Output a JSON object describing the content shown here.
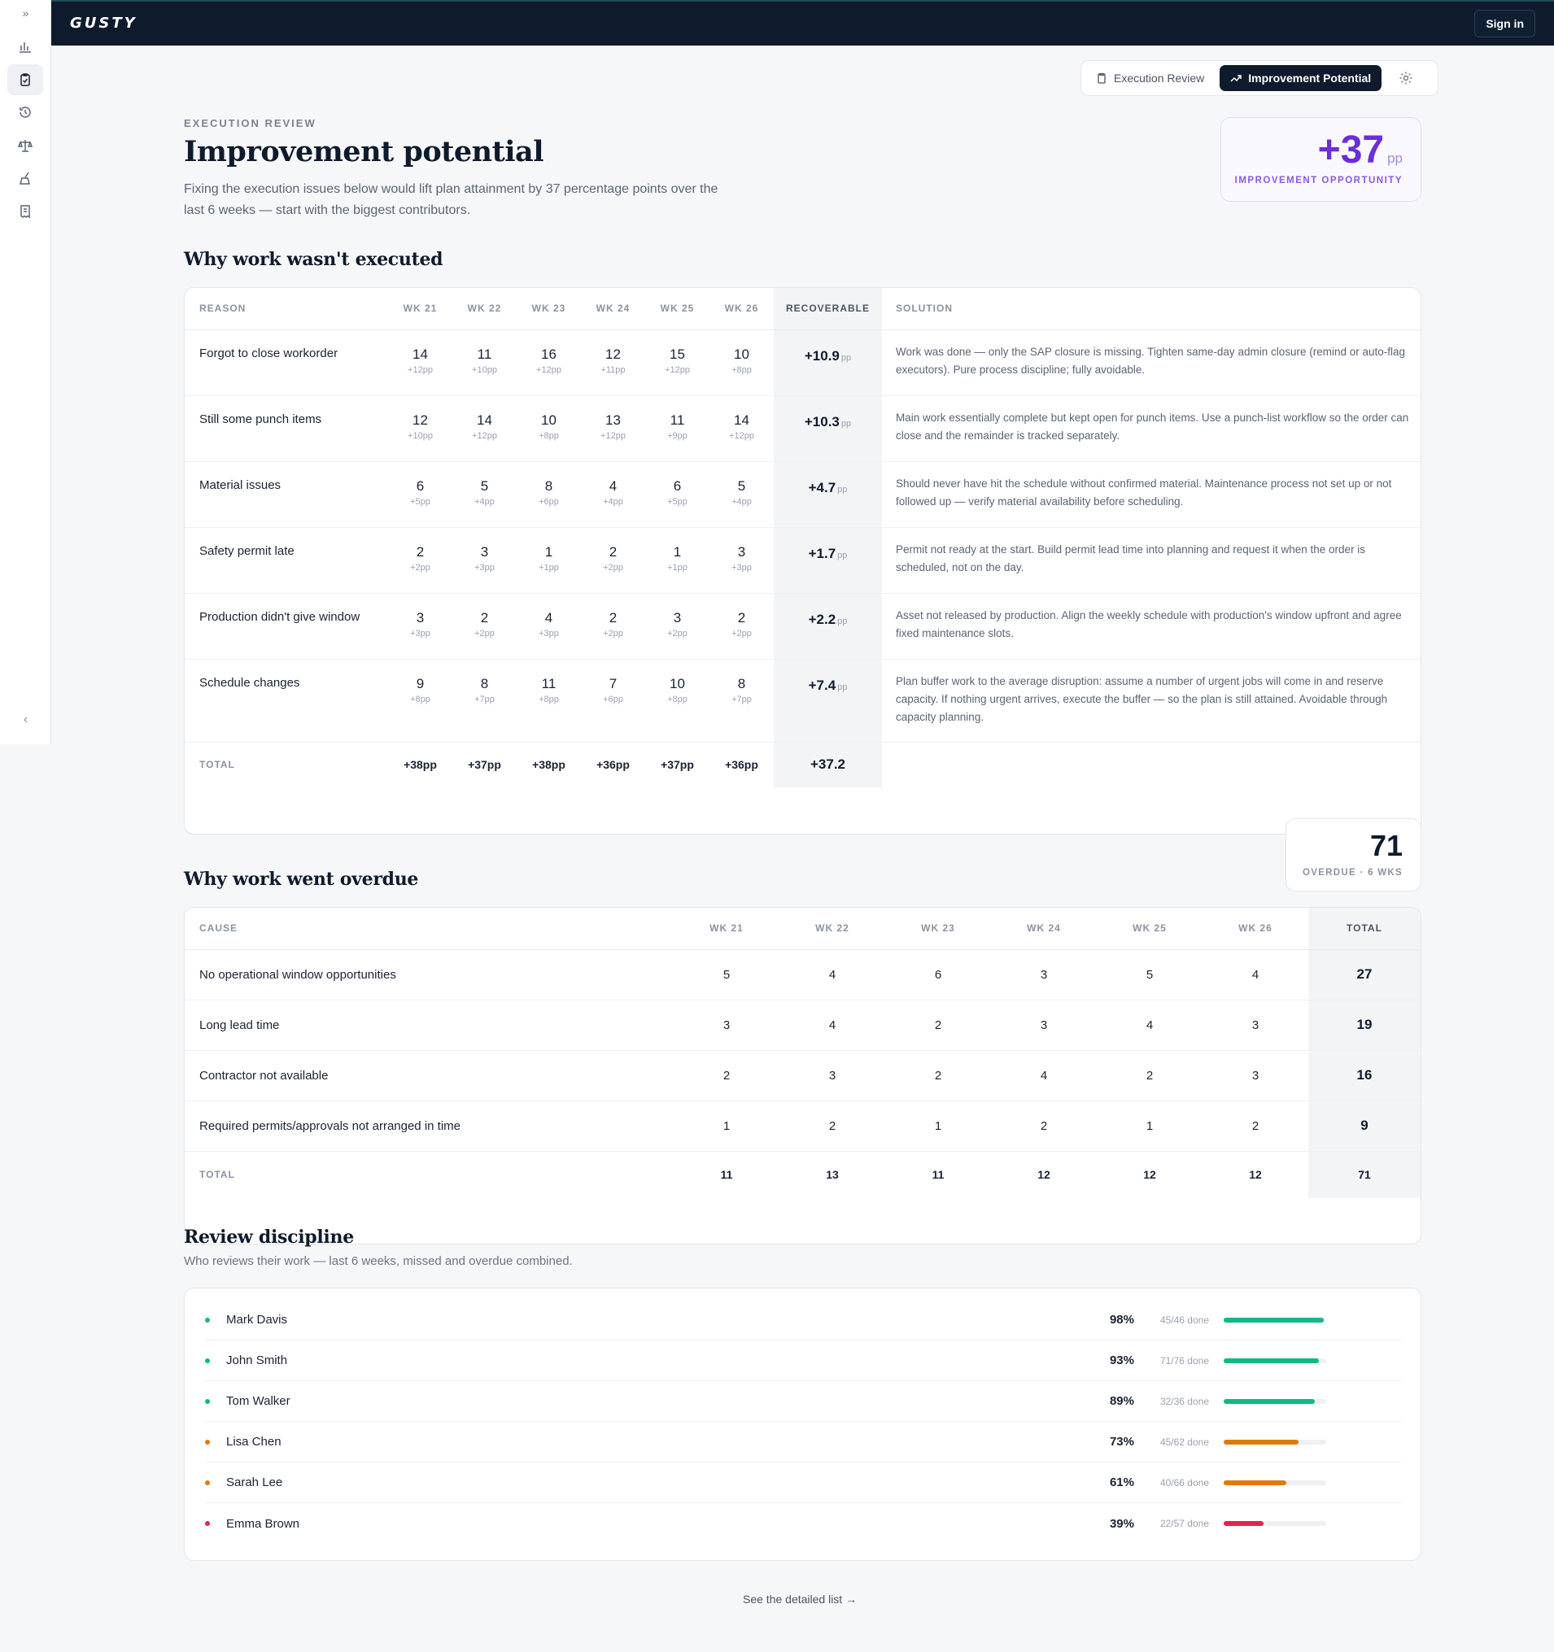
{
  "sidebar": {
    "expand_glyph": "»",
    "collapse_glyph": "‹",
    "items": [
      {
        "icon": "bar-chart-icon"
      },
      {
        "icon": "clipboard-check-icon",
        "active": true
      },
      {
        "icon": "history-icon"
      },
      {
        "icon": "scale-icon"
      },
      {
        "icon": "broom-icon"
      },
      {
        "icon": "receipt-icon"
      }
    ]
  },
  "topbar": {
    "logo": "GUSTY",
    "signin_label": "Sign in"
  },
  "tabs": [
    {
      "label": "Execution Review",
      "icon": "clipboard-icon",
      "active": false
    },
    {
      "label": "Improvement Potential",
      "icon": "trending-up-icon",
      "active": true
    }
  ],
  "header": {
    "eyebrow": "EXECUTION REVIEW",
    "title": "Improvement potential",
    "subtitle": "Fixing the execution issues below would lift plan attainment by 37 percentage points over the last 6 weeks — start with the biggest contributors."
  },
  "kpi": {
    "value": "+37",
    "unit": "pp",
    "label": "IMPROVEMENT OPPORTUNITY",
    "color": "#6a2fd6"
  },
  "not_executed": {
    "title": "Why work wasn't executed",
    "headers": [
      "REASON",
      "WK 21",
      "WK 22",
      "WK 23",
      "WK 24",
      "WK 25",
      "WK 26",
      "RECOVERABLE",
      "SOLUTION"
    ],
    "rows": [
      {
        "reason": "Forgot to close workorder",
        "counts": [
          "14",
          "11",
          "16",
          "12",
          "15",
          "10"
        ],
        "pp": [
          "+12pp",
          "+10pp",
          "+12pp",
          "+11pp",
          "+12pp",
          "+8pp"
        ],
        "recoverable": "+10.9",
        "unit": "pp",
        "solution": "Work was done — only the SAP closure is missing. Tighten same-day admin closure (remind or auto-flag executors). Pure process discipline; fully avoidable."
      },
      {
        "reason": "Still some punch items",
        "counts": [
          "12",
          "14",
          "10",
          "13",
          "11",
          "14"
        ],
        "pp": [
          "+10pp",
          "+12pp",
          "+8pp",
          "+12pp",
          "+9pp",
          "+12pp"
        ],
        "recoverable": "+10.3",
        "unit": "pp",
        "solution": "Main work essentially complete but kept open for punch items. Use a punch-list workflow so the order can close and the remainder is tracked separately."
      },
      {
        "reason": "Material issues",
        "counts": [
          "6",
          "5",
          "8",
          "4",
          "6",
          "5"
        ],
        "pp": [
          "+5pp",
          "+4pp",
          "+6pp",
          "+4pp",
          "+5pp",
          "+4pp"
        ],
        "recoverable": "+4.7",
        "unit": "pp",
        "solution": "Should never have hit the schedule without confirmed material. Maintenance process not set up or not followed up — verify material availability before scheduling."
      },
      {
        "reason": "Safety permit late",
        "counts": [
          "2",
          "3",
          "1",
          "2",
          "1",
          "3"
        ],
        "pp": [
          "+2pp",
          "+3pp",
          "+1pp",
          "+2pp",
          "+1pp",
          "+3pp"
        ],
        "recoverable": "+1.7",
        "unit": "pp",
        "solution": "Permit not ready at the start. Build permit lead time into planning and request it when the order is scheduled, not on the day."
      },
      {
        "reason": "Production didn't give window",
        "counts": [
          "3",
          "2",
          "4",
          "2",
          "3",
          "2"
        ],
        "pp": [
          "+3pp",
          "+2pp",
          "+3pp",
          "+2pp",
          "+2pp",
          "+2pp"
        ],
        "recoverable": "+2.2",
        "unit": "pp",
        "solution": "Asset not released by production. Align the weekly schedule with production's window upfront and agree fixed maintenance slots."
      },
      {
        "reason": "Schedule changes",
        "counts": [
          "9",
          "8",
          "11",
          "7",
          "10",
          "8"
        ],
        "pp": [
          "+8pp",
          "+7pp",
          "+8pp",
          "+6pp",
          "+8pp",
          "+7pp"
        ],
        "recoverable": "+7.4",
        "unit": "pp",
        "solution": "Plan buffer work to the average disruption: assume a number of urgent jobs will come in and reserve capacity. If nothing urgent arrives, execute the buffer — so the plan is still attained. Avoidable through capacity planning."
      }
    ],
    "total": {
      "label": "TOTAL",
      "weeks": [
        "+38pp",
        "+37pp",
        "+38pp",
        "+36pp",
        "+37pp",
        "+36pp"
      ],
      "recoverable": "+37.2"
    }
  },
  "overdue": {
    "title": "Why work went overdue",
    "kpi_value": "71",
    "kpi_label": "OVERDUE · 6 WKS",
    "headers": [
      "CAUSE",
      "WK 21",
      "WK 22",
      "WK 23",
      "WK 24",
      "WK 25",
      "WK 26",
      "TOTAL"
    ],
    "rows": [
      {
        "cause": "No operational window opportunities",
        "weeks": [
          "5",
          "4",
          "6",
          "3",
          "5",
          "4"
        ],
        "total": "27"
      },
      {
        "cause": "Long lead time",
        "weeks": [
          "3",
          "4",
          "2",
          "3",
          "4",
          "3"
        ],
        "total": "19"
      },
      {
        "cause": "Contractor not available",
        "weeks": [
          "2",
          "3",
          "2",
          "4",
          "2",
          "3"
        ],
        "total": "16"
      },
      {
        "cause": "Required permits/approvals not arranged in time",
        "weeks": [
          "1",
          "2",
          "1",
          "2",
          "1",
          "2"
        ],
        "total": "9"
      }
    ],
    "total": {
      "label": "TOTAL",
      "weeks": [
        "11",
        "13",
        "11",
        "12",
        "12",
        "12"
      ],
      "total": "71"
    }
  },
  "review": {
    "title": "Review discipline",
    "subtitle": "Who reviews their work — last 6 weeks, missed and overdue combined.",
    "people": [
      {
        "name": "Mark Davis",
        "pct": "98%",
        "done": "45/46 done",
        "fraction": 0.98,
        "color": "#12b886"
      },
      {
        "name": "John Smith",
        "pct": "93%",
        "done": "71/76 done",
        "fraction": 0.93,
        "color": "#12b886"
      },
      {
        "name": "Tom Walker",
        "pct": "89%",
        "done": "32/36 done",
        "fraction": 0.89,
        "color": "#12b886"
      },
      {
        "name": "Lisa Chen",
        "pct": "73%",
        "done": "45/62 done",
        "fraction": 0.73,
        "color": "#e07a10"
      },
      {
        "name": "Sarah Lee",
        "pct": "61%",
        "done": "40/66 done",
        "fraction": 0.61,
        "color": "#e07a10"
      },
      {
        "name": "Emma Brown",
        "pct": "39%",
        "done": "22/57 done",
        "fraction": 0.39,
        "color": "#e0244f"
      }
    ]
  },
  "footer": {
    "detail_link": "See the detailed list →"
  }
}
